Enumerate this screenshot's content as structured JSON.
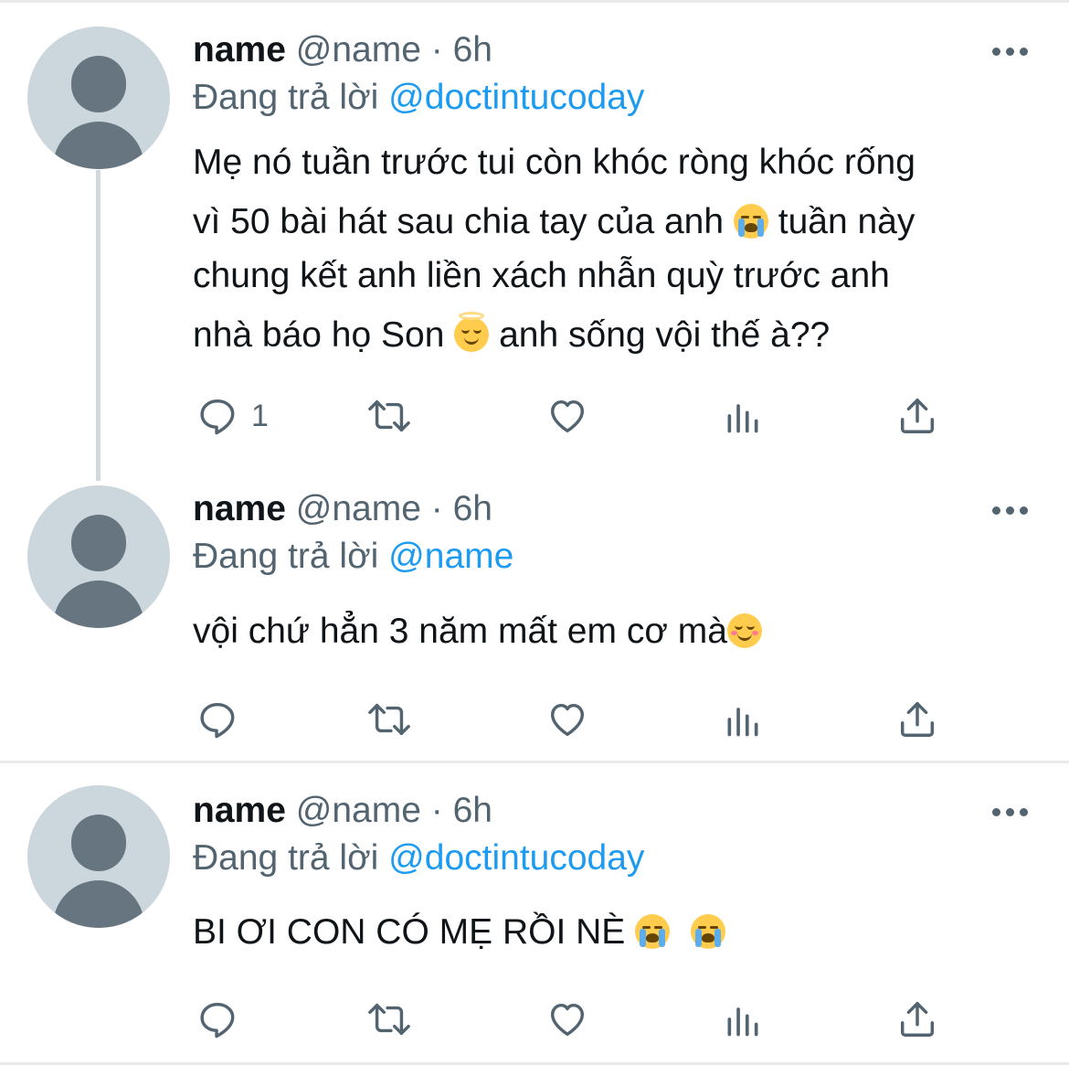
{
  "tweets": [
    {
      "name": "name",
      "handle": "@name",
      "dot": "·",
      "time": "6h",
      "replying_prefix": "Đang trả lời",
      "replying_to": "@doctintucoday",
      "lines": [
        [
          "Mẹ nó tuần trước tui còn khóc ròng khóc rống"
        ],
        [
          "vì 50 bài hát sau chia tay của anh ",
          "  tuần này"
        ],
        [
          "chung kết anh liền xách nhẫn quỳ trước anh"
        ],
        [
          "nhà báo họ Son ",
          "  anh sống vội thế à??"
        ]
      ],
      "reply_count": "1"
    },
    {
      "name": "name",
      "handle": "@name",
      "dot": "·",
      "time": "6h",
      "replying_prefix": "Đang trả lời",
      "replying_to": "@name",
      "lines": [
        [
          "vội chứ hẳn 3 năm mất em cơ mà"
        ]
      ],
      "reply_count": ""
    },
    {
      "name": "name",
      "handle": "@name",
      "dot": "·",
      "time": "6h",
      "replying_prefix": "Đang trả lời",
      "replying_to": "@doctintucoday",
      "lines": [
        [
          "BI ƠI CON CÓ MẸ RỒI NÈ "
        ]
      ],
      "reply_count": ""
    }
  ],
  "emojis": {
    "t1_line2": "loudly-crying-face",
    "t1_line4": "smiling-face-with-halo",
    "t2_line1": "relieved-face",
    "t3_line1": [
      "loudly-crying-face",
      "loudly-crying-face"
    ]
  },
  "icons": [
    "reply-icon",
    "retweet-icon",
    "like-icon",
    "analytics-icon",
    "share-icon",
    "more-icon"
  ],
  "colors": {
    "text": "#0f1419",
    "secondary": "#536471",
    "mention": "#1d9bf0",
    "avatar_bg": "#ccd6dd",
    "avatar_fg": "#66757f",
    "divider": "#e7e9eb",
    "thread_line": "#cfd9de"
  }
}
